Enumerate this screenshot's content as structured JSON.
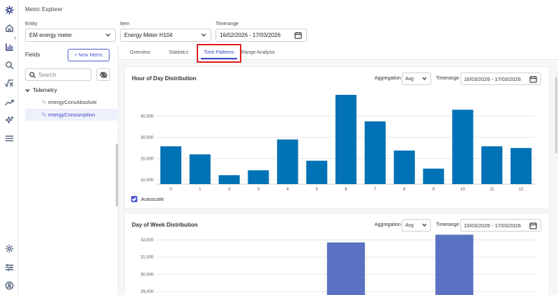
{
  "app": {
    "title": "Metric Explorer"
  },
  "rail": {
    "top_icons": [
      "app-logo-icon",
      "home-icon",
      "bar-chart-icon",
      "search-analytics-icon",
      "formula-icon",
      "trend-line-icon",
      "sparkle-icon",
      "menu-icon"
    ],
    "bottom_icons": [
      "settings-icon",
      "sliders-icon",
      "user-icon"
    ]
  },
  "filters": {
    "entity": {
      "label": "Entity",
      "value": "EM energy meter"
    },
    "item": {
      "label": "Item",
      "value": "Energy Meter H104"
    },
    "timerange": {
      "label": "Timerange",
      "value": "16/02/2026 - 17/03/2026"
    }
  },
  "fields": {
    "title": "Fields",
    "new_metric": "+ New Metric",
    "search_placeholder": "Search",
    "group": "Telemetry",
    "items": [
      {
        "prefix": "¹/₀",
        "label": "energyConsAbsolute"
      },
      {
        "prefix": "¹/₀",
        "label": "energyConsumption"
      }
    ]
  },
  "tabs": [
    "Overview",
    "Statistics",
    "Time Patterns",
    "Range Analysis"
  ],
  "active_tab": "Time Patterns",
  "hour_card": {
    "title": "Hour of Day Distribution",
    "aggregation_label": "Aggregation",
    "aggregation_value": "Avg",
    "timerange_label": "Timerange",
    "timerange_value": "16/03/2026 - 17/03/2026",
    "autoscale_label": "Autoscale"
  },
  "week_card": {
    "title": "Day of Week Distribution",
    "aggregation_label": "Aggregation",
    "aggregation_value": "Avg",
    "timerange_label": "Timerange",
    "timerange_value": "10/03/2026 - 17/03/2026"
  },
  "chart_data": [
    {
      "type": "bar",
      "title": "Hour of Day Distribution",
      "categories": [
        "0",
        "1",
        "2",
        "3",
        "4",
        "5",
        "6",
        "7",
        "8",
        "9",
        "10",
        "11",
        "12"
      ],
      "values": [
        25800,
        22000,
        12200,
        14500,
        29000,
        19000,
        50000,
        37500,
        23800,
        15300,
        43000,
        25800,
        25000
      ],
      "ylim": [
        8000,
        50000
      ],
      "yticks": [
        10000,
        20000,
        30000,
        40000
      ],
      "ytick_labels": [
        "10,000",
        "20,000",
        "30,000",
        "40,000"
      ],
      "color": "#0072b5",
      "grid": true
    },
    {
      "type": "bar",
      "title": "Day of Week Distribution",
      "bars_visible": [
        {
          "value": 31850
        },
        {
          "value": 32300
        }
      ],
      "ylim": [
        28800,
        32200
      ],
      "yticks": [
        29000,
        30000,
        31000,
        32000
      ],
      "ytick_labels": [
        "29,000",
        "30,000",
        "31,000",
        "32,000"
      ],
      "color": "#5b72c2",
      "grid": true
    }
  ]
}
